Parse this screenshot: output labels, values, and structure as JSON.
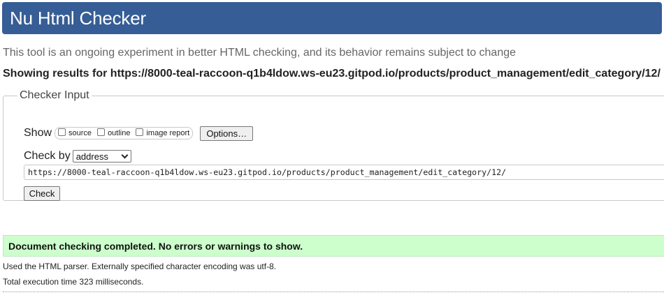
{
  "header": {
    "title": "Nu Html Checker",
    "bg_color": "#365d95"
  },
  "subtitle": "This tool is an ongoing experiment in better HTML checking, and its behavior remains subject to change",
  "results_for": "Showing results for https://8000-teal-raccoon-q1b4ldow.ws-eu23.gitpod.io/products/product_management/edit_category/12/",
  "checker_input": {
    "legend": "Checker Input",
    "show_label": "Show",
    "show_options": [
      {
        "label": "source",
        "checked": false
      },
      {
        "label": "outline",
        "checked": false
      },
      {
        "label": "image report",
        "checked": false
      }
    ],
    "options_button": "Options…",
    "check_by_label": "Check by",
    "check_by_selected": "address",
    "url_value": "https://8000-teal-raccoon-q1b4ldow.ws-eu23.gitpod.io/products/product_management/edit_category/12/",
    "check_button": "Check"
  },
  "result": {
    "message": "Document checking completed. No errors or warnings to show.",
    "bg_color": "#ccffcc"
  },
  "info": {
    "parser": "Used the HTML parser. Externally specified character encoding was utf-8.",
    "execution_time": "Total execution time 323 milliseconds."
  }
}
